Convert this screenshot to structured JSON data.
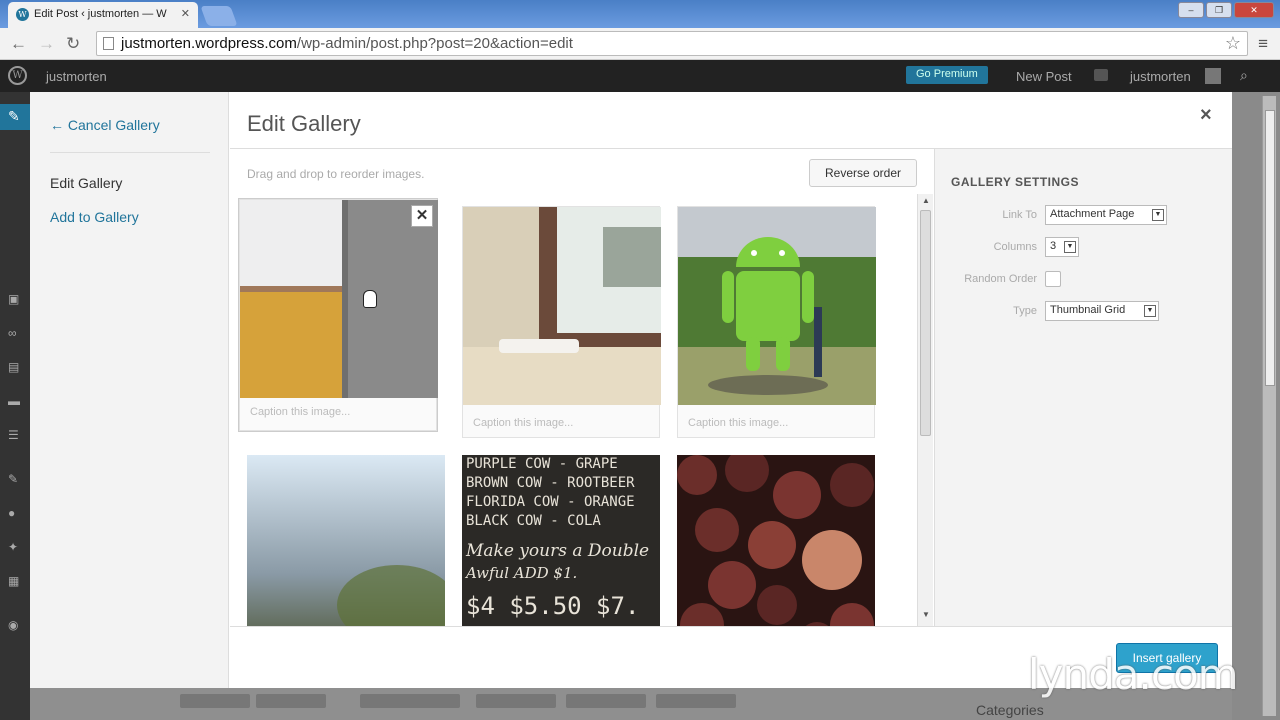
{
  "browser": {
    "tab_title": "Edit Post ‹ justmorten — W",
    "url_host": "justmorten.wordpress.com",
    "url_path": "/wp-admin/post.php?post=20&action=edit"
  },
  "adminbar": {
    "site_name": "justmorten",
    "go_premium": "Go Premium",
    "new_post": "New Post",
    "user": "justmorten"
  },
  "modal": {
    "cancel_link": "← Cancel Gallery",
    "menu_edit": "Edit Gallery",
    "menu_add": "Add to Gallery",
    "title": "Edit Gallery",
    "hint": "Drag and drop to reorder images.",
    "reverse_button": "Reverse order",
    "caption_placeholder": "Caption this image...",
    "insert_button": "Insert gallery"
  },
  "gallery_images": [
    {
      "name": "wall-corner",
      "colors": [
        "#f0f0f2",
        "#d6a23a",
        "#8a8a8a"
      ]
    },
    {
      "name": "window-sill",
      "colors": [
        "#c9c2b0",
        "#6b4a3a",
        "#e9e1cf"
      ]
    },
    {
      "name": "android-statue",
      "colors": [
        "#7fcf3f",
        "#4f8a2e",
        "#c4c9cf"
      ]
    },
    {
      "name": "misty-window",
      "colors": [
        "#dce8f2",
        "#7a8fa0",
        "#4e5a38"
      ]
    },
    {
      "name": "chalkboard-menu",
      "colors": [
        "#2b2926",
        "#e8e3d8"
      ]
    },
    {
      "name": "grapes",
      "colors": [
        "#6b2e2a",
        "#c9866a",
        "#3a1a18"
      ]
    }
  ],
  "chalkboard_lines": [
    "PURPLE COW - GRAPE",
    "BROWN COW - ROOTBEER",
    "FLORIDA COW - ORANGE",
    "BLACK COW - COLA",
    "Make yours a Double",
    "Awful  ADD $1.",
    "$4  $5.50  $7."
  ],
  "settings": {
    "heading": "GALLERY SETTINGS",
    "link_to_label": "Link To",
    "link_to_value": "Attachment Page",
    "columns_label": "Columns",
    "columns_value": "3",
    "random_label": "Random Order",
    "type_label": "Type",
    "type_value": "Thumbnail Grid"
  },
  "background": {
    "categories": "Categories"
  },
  "watermark": "lynda.com",
  "colors": {
    "accent": "#21759b",
    "insert_button": "#2ea2cc",
    "admin_bar": "#222222"
  }
}
